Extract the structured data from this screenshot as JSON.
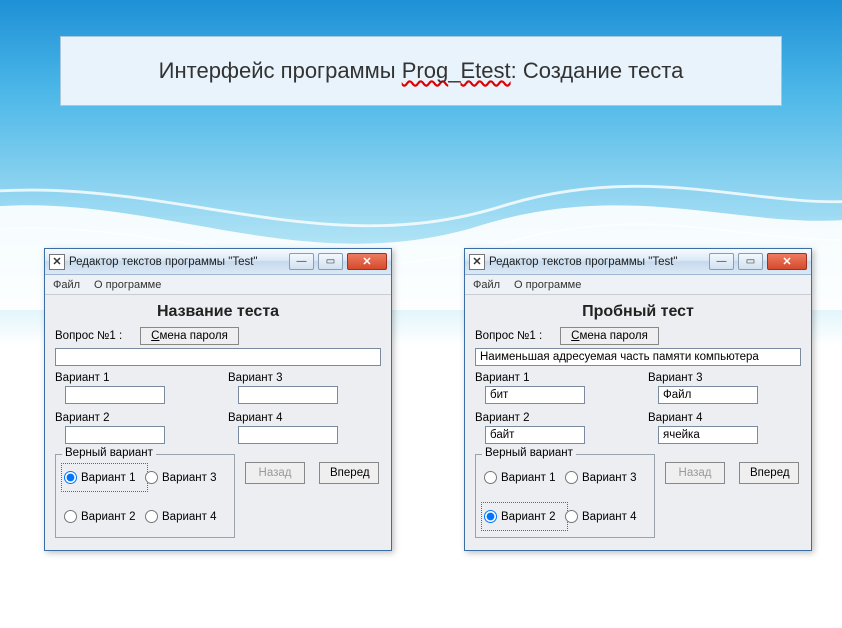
{
  "slide_title_parts": {
    "prefix": "Интерфейс программы ",
    "wavy1": "Prog",
    "us": "_",
    "wavy2": "Etest",
    "suffix": ": Создание теста"
  },
  "windows": [
    {
      "window_title": "Редактор текстов программы \"Test\"",
      "menu": {
        "file": "Файл",
        "about": "О программе"
      },
      "test_title": "Название теста",
      "question_label": "Вопрос №1 :",
      "pwd_button": "Смена пароля",
      "question_value": "",
      "variants": {
        "labels": [
          "Вариант 1",
          "Вариант 2",
          "Вариант 3",
          "Вариант 4"
        ],
        "values": [
          "",
          "",
          "",
          ""
        ]
      },
      "correct": {
        "legend": "Верный вариант",
        "options": [
          "Вариант 1",
          "Вариант 2",
          "Вариант 3",
          "Вариант 4"
        ],
        "selected": 0,
        "focused": 0
      },
      "nav": {
        "back": "Назад",
        "back_disabled": true,
        "forward": "Вперед"
      }
    },
    {
      "window_title": "Редактор текстов программы \"Test\"",
      "menu": {
        "file": "Файл",
        "about": "О программе"
      },
      "test_title": "Пробный тест",
      "question_label": "Вопрос №1 :",
      "pwd_button": "Смена пароля",
      "question_value": "Наименьшая адресуемая часть памяти компьютера",
      "variants": {
        "labels": [
          "Вариант 1",
          "Вариант 2",
          "Вариант 3",
          "Вариант 4"
        ],
        "values": [
          "бит",
          "байт",
          "Файл",
          "ячейка"
        ]
      },
      "correct": {
        "legend": "Верный вариант",
        "options": [
          "Вариант 1",
          "Вариант 2",
          "Вариант 3",
          "Вариант 4"
        ],
        "selected": 1,
        "focused": 1
      },
      "nav": {
        "back": "Назад",
        "back_disabled": true,
        "forward": "Вперед"
      }
    }
  ]
}
